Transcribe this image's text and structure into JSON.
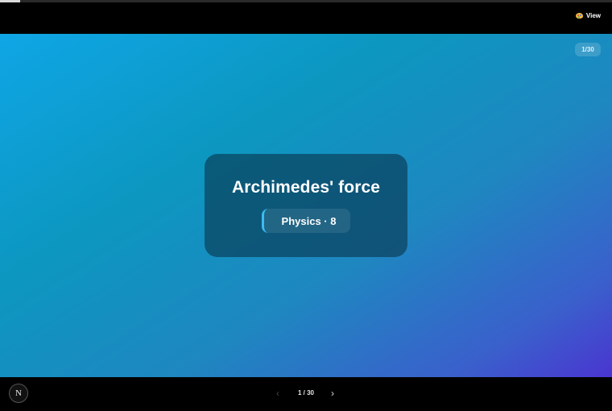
{
  "progress": {
    "fraction": 0.0333
  },
  "topbar": {
    "view_label": "View",
    "view_icon": "palette-icon"
  },
  "slide": {
    "counter": "1/30",
    "title": "Archimedes' force",
    "subject": "Physics · 8",
    "accent_color": "#3bbdf2"
  },
  "bottombar": {
    "logo_letter": "N",
    "prev_icon": "chevron-left-icon",
    "next_icon": "chevron-right-icon",
    "page_indicator": "1 / 30",
    "prev_glyph": "‹",
    "next_glyph": "›"
  }
}
